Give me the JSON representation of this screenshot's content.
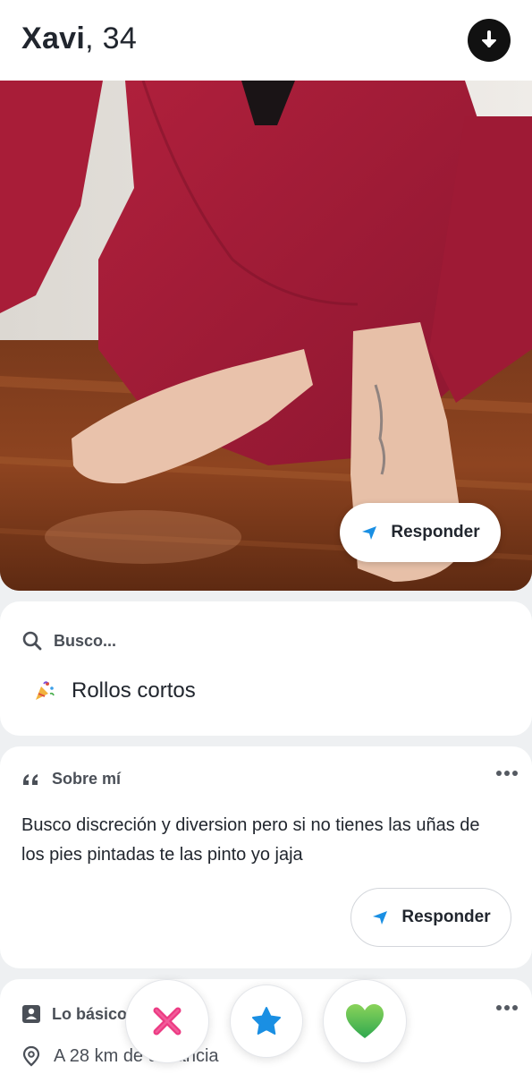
{
  "header": {
    "name": "Xavi",
    "age_sep": ", ",
    "age": "34",
    "download_icon": "arrow-down-circle-icon"
  },
  "photo": {
    "reply_label": "Responder",
    "reply_icon": "paper-plane-icon"
  },
  "looking_for": {
    "label": "Busco...",
    "icon": "search-icon",
    "value": "Rollos cortos",
    "value_icon": "party-popper-icon"
  },
  "about": {
    "label": "Sobre mí",
    "icon": "quote-icon",
    "text": "Busco discreción y diversion pero si no tienes las uñas de los pies pintadas te las pinto yo jaja",
    "reply_label": "Responder",
    "more_icon": "more-dots-icon"
  },
  "basics": {
    "label": "Lo básico",
    "icon": "id-card-icon",
    "distance": "A 28 km de distancia",
    "distance_icon": "location-pin-icon",
    "more_icon": "more-dots-icon"
  },
  "actions": [
    {
      "name": "dislike",
      "icon": "x-icon",
      "color": "#ec3b83"
    },
    {
      "name": "super-like",
      "icon": "star-icon",
      "color": "#1a8fe3"
    },
    {
      "name": "like",
      "icon": "heart-icon",
      "color": "#6cc04a"
    }
  ],
  "colors": {
    "accent": "#1a8fe3",
    "text": "#21262e",
    "background": "#eef0f2"
  }
}
